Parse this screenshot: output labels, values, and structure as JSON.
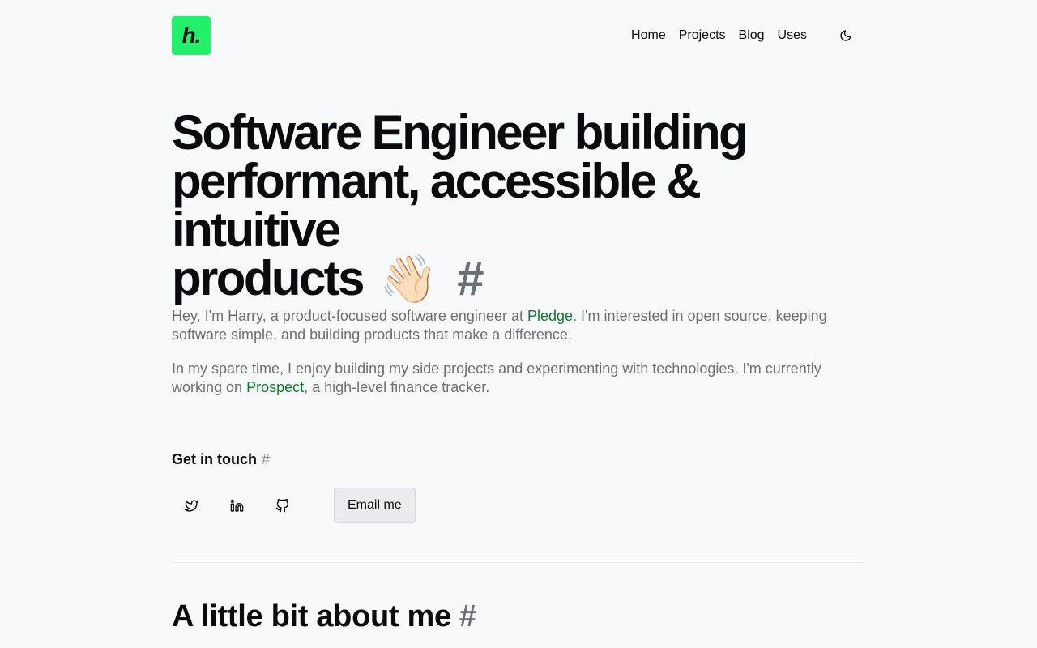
{
  "header": {
    "logo_text": "h.",
    "nav": [
      {
        "label": "Home"
      },
      {
        "label": "Projects"
      },
      {
        "label": "Blog"
      },
      {
        "label": "Uses"
      }
    ],
    "theme_toggle_icon": "moon-icon"
  },
  "hero": {
    "line1": "Software Engineer building",
    "line2": "performant, accessible & intuitive",
    "line3": "products",
    "wave": "👋🏻",
    "hash": "#"
  },
  "intro": {
    "p1_before": "Hey, I'm Harry, a product-focused software engineer at ",
    "p1_link": "Pledge",
    "p1_after": ". I'm interested in open source, keeping software simple, and building products that make a difference.",
    "p2_before": "In my spare time, I enjoy building my side projects and experimenting with technologies. I'm currently working on ",
    "p2_link": "Prospect",
    "p2_after": ", a high-level finance tracker."
  },
  "contact": {
    "title": "Get in touch",
    "hash": "#",
    "socials": [
      "twitter-icon",
      "linkedin-icon",
      "github-icon"
    ],
    "email_label": "Email me"
  },
  "about": {
    "title": "A little bit about me",
    "hash": "#"
  },
  "colors": {
    "brand": "#22f06a",
    "link": "#0f7a2c",
    "muted": "#6b7076",
    "background": "#f8f9fb"
  }
}
